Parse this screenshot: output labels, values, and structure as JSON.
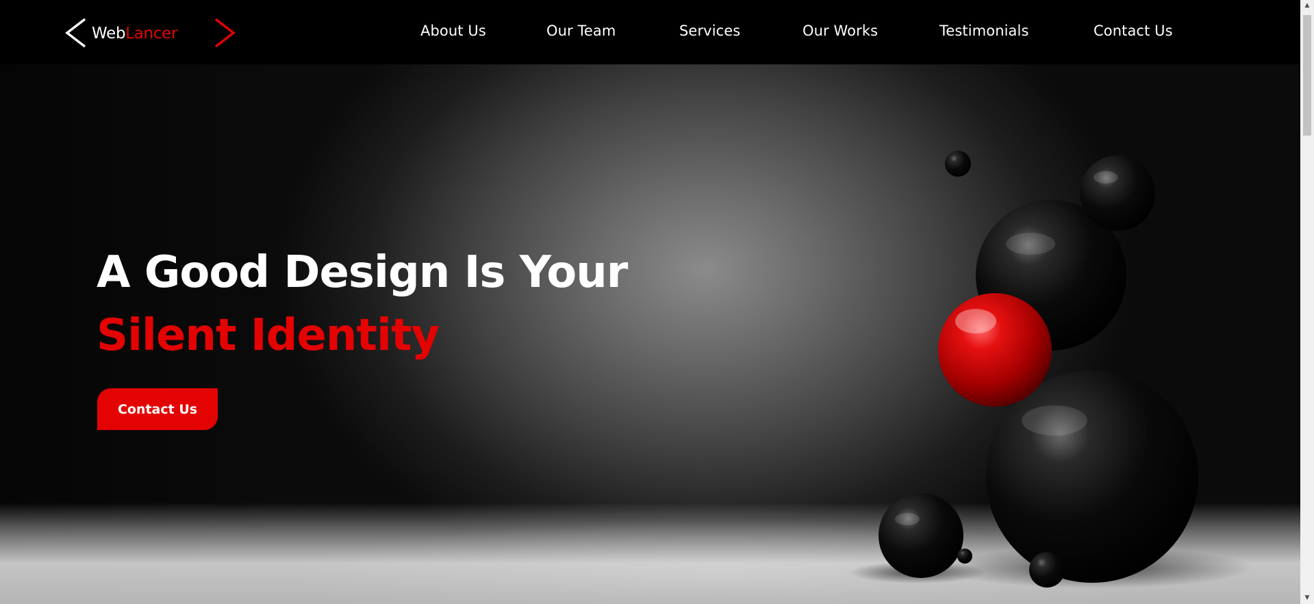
{
  "brand": {
    "name_part1": "Web",
    "name_part2": "Lancer",
    "accent_color": "#e40303"
  },
  "nav": {
    "items": [
      {
        "label": "About Us"
      },
      {
        "label": "Our Team"
      },
      {
        "label": "Services"
      },
      {
        "label": "Our Works"
      },
      {
        "label": "Testimonials"
      },
      {
        "label": "Contact Us"
      }
    ]
  },
  "hero": {
    "headline_line1": "A Good Design Is Your",
    "headline_line2": "Silent Identity",
    "cta_label": "Contact Us"
  },
  "scrollbar": {
    "up_icon": "arrow-up",
    "down_icon": "arrow-down"
  }
}
